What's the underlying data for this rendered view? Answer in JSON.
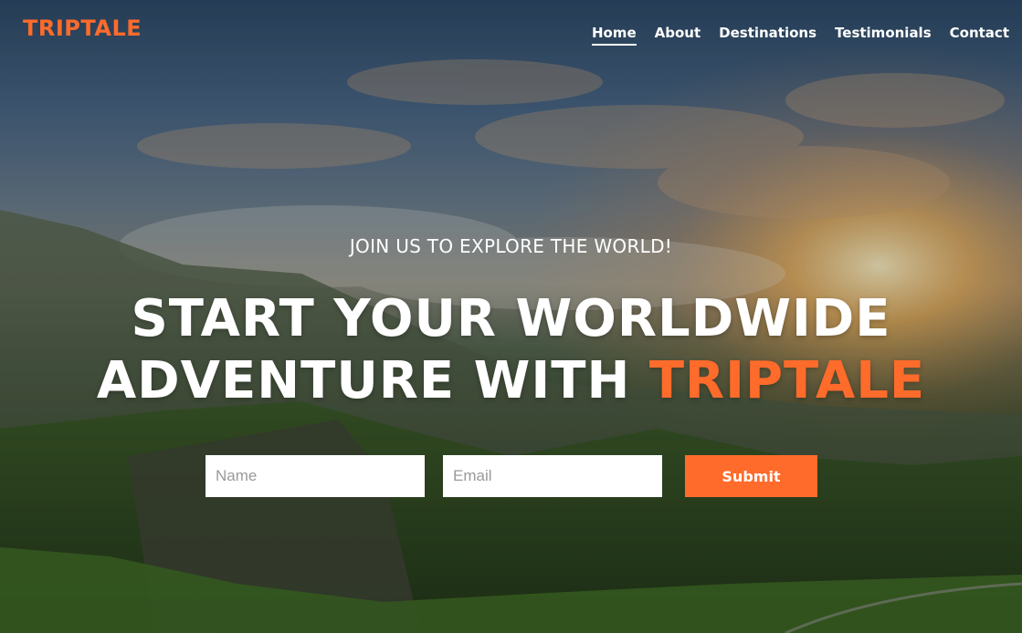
{
  "brand": {
    "name": "TRIPTALE",
    "accent_color": "#ff6b2b"
  },
  "nav": {
    "items": [
      {
        "label": "Home",
        "active": true
      },
      {
        "label": "About"
      },
      {
        "label": "Destinations"
      },
      {
        "label": "Testimonials"
      },
      {
        "label": "Contact"
      }
    ]
  },
  "hero": {
    "tagline": "JOIN US TO EXPLORE THE WORLD!",
    "headline_line1": "START YOUR WORLDWIDE",
    "headline_line2_prefix": "ADVENTURE WITH",
    "headline_accent": "TRIPTALE",
    "background": "mountain-valley-sunset-image"
  },
  "signup": {
    "name_placeholder": "Name",
    "email_placeholder": "Email",
    "submit_label": "Submit"
  }
}
